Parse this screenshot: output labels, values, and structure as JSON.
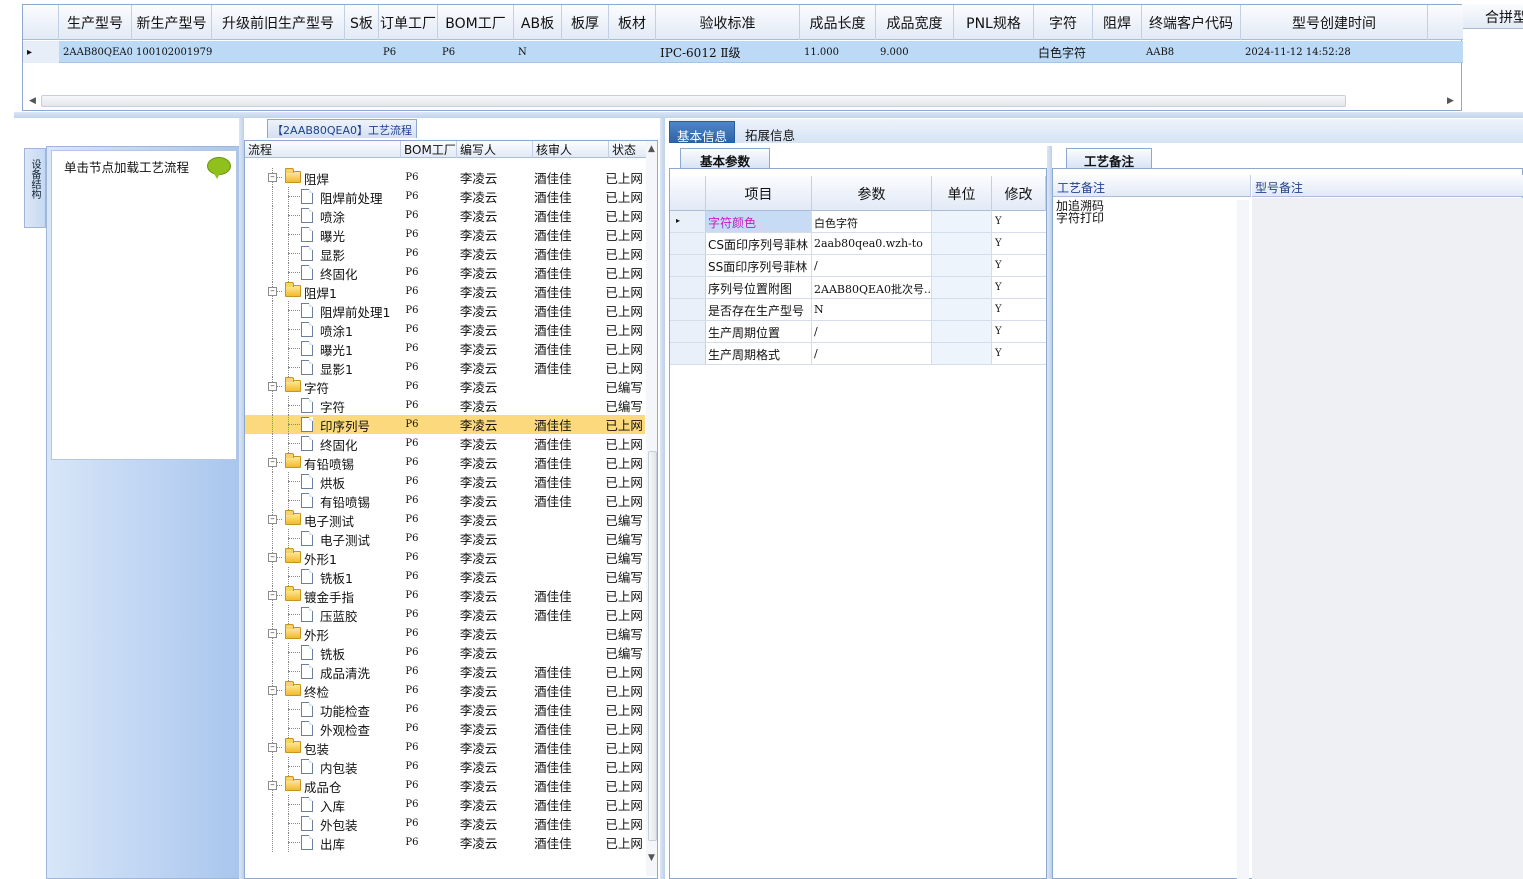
{
  "top_grid": {
    "headers": [
      "生产型号",
      "新生产型号",
      "升级前旧生产型号",
      "S板",
      "订单工厂",
      "BOM工厂",
      "AB板",
      "板厚",
      "板材",
      "验收标准",
      "成品长度",
      "成品宽度",
      "PNL规格",
      "字符",
      "阻焊",
      "终端客户代码",
      "型号创建时间"
    ],
    "row": [
      "2AAB80QEA0",
      "10010200197916",
      "",
      "",
      "P6",
      "P6",
      "N",
      "",
      "",
      "IPC-6012 Ⅱ级",
      "11.000",
      "9.000",
      "",
      "白色字符",
      "",
      "AAB8",
      "2024-11-12 14:52:28"
    ]
  },
  "merge_label": "合拼型",
  "left_panel": {
    "vertical_tab": "设备结构",
    "hint": "单击节点加载工艺流程"
  },
  "process": {
    "title": "【2AAB80QEA0】工艺流程",
    "headers": [
      "流程",
      "BOM工厂",
      "编写人",
      "核审人",
      "状态"
    ],
    "rows": [
      {
        "level": 1,
        "type": "folder",
        "name": "阻焊",
        "bom": "P6",
        "writer": "李凌云",
        "reviewer": "酒佳佳",
        "status": "已上网"
      },
      {
        "level": 2,
        "type": "doc",
        "name": "阻焊前处理",
        "bom": "P6",
        "writer": "李凌云",
        "reviewer": "酒佳佳",
        "status": "已上网"
      },
      {
        "level": 2,
        "type": "doc",
        "name": "喷涂",
        "bom": "P6",
        "writer": "李凌云",
        "reviewer": "酒佳佳",
        "status": "已上网"
      },
      {
        "level": 2,
        "type": "doc",
        "name": "曝光",
        "bom": "P6",
        "writer": "李凌云",
        "reviewer": "酒佳佳",
        "status": "已上网"
      },
      {
        "level": 2,
        "type": "doc",
        "name": "显影",
        "bom": "P6",
        "writer": "李凌云",
        "reviewer": "酒佳佳",
        "status": "已上网"
      },
      {
        "level": 2,
        "type": "doc",
        "name": "终固化",
        "bom": "P6",
        "writer": "李凌云",
        "reviewer": "酒佳佳",
        "status": "已上网"
      },
      {
        "level": 1,
        "type": "folder",
        "name": "阻焊1",
        "bom": "P6",
        "writer": "李凌云",
        "reviewer": "酒佳佳",
        "status": "已上网"
      },
      {
        "level": 2,
        "type": "doc",
        "name": "阻焊前处理1",
        "bom": "P6",
        "writer": "李凌云",
        "reviewer": "酒佳佳",
        "status": "已上网"
      },
      {
        "level": 2,
        "type": "doc",
        "name": "喷涂1",
        "bom": "P6",
        "writer": "李凌云",
        "reviewer": "酒佳佳",
        "status": "已上网"
      },
      {
        "level": 2,
        "type": "doc",
        "name": "曝光1",
        "bom": "P6",
        "writer": "李凌云",
        "reviewer": "酒佳佳",
        "status": "已上网"
      },
      {
        "level": 2,
        "type": "doc",
        "name": "显影1",
        "bom": "P6",
        "writer": "李凌云",
        "reviewer": "酒佳佳",
        "status": "已上网"
      },
      {
        "level": 1,
        "type": "folder",
        "name": "字符",
        "bom": "P6",
        "writer": "李凌云",
        "reviewer": "",
        "status": "已编写"
      },
      {
        "level": 2,
        "type": "doc",
        "name": "字符",
        "bom": "P6",
        "writer": "李凌云",
        "reviewer": "",
        "status": "已编写"
      },
      {
        "level": 2,
        "type": "doc",
        "name": "印序列号",
        "bom": "P6",
        "writer": "李凌云",
        "reviewer": "酒佳佳",
        "status": "已上网",
        "selected": true
      },
      {
        "level": 2,
        "type": "doc",
        "name": "终固化",
        "bom": "P6",
        "writer": "李凌云",
        "reviewer": "酒佳佳",
        "status": "已上网"
      },
      {
        "level": 1,
        "type": "folder",
        "name": "有铅喷锡",
        "bom": "P6",
        "writer": "李凌云",
        "reviewer": "酒佳佳",
        "status": "已上网"
      },
      {
        "level": 2,
        "type": "doc",
        "name": "烘板",
        "bom": "P6",
        "writer": "李凌云",
        "reviewer": "酒佳佳",
        "status": "已上网"
      },
      {
        "level": 2,
        "type": "doc",
        "name": "有铅喷锡",
        "bom": "P6",
        "writer": "李凌云",
        "reviewer": "酒佳佳",
        "status": "已上网"
      },
      {
        "level": 1,
        "type": "folder",
        "name": "电子测试",
        "bom": "P6",
        "writer": "李凌云",
        "reviewer": "",
        "status": "已编写"
      },
      {
        "level": 2,
        "type": "doc",
        "name": "电子测试",
        "bom": "P6",
        "writer": "李凌云",
        "reviewer": "",
        "status": "已编写"
      },
      {
        "level": 1,
        "type": "folder",
        "name": "外形1",
        "bom": "P6",
        "writer": "李凌云",
        "reviewer": "",
        "status": "已编写"
      },
      {
        "level": 2,
        "type": "doc",
        "name": "铣板1",
        "bom": "P6",
        "writer": "李凌云",
        "reviewer": "",
        "status": "已编写"
      },
      {
        "level": 1,
        "type": "folder",
        "name": "镀金手指",
        "bom": "P6",
        "writer": "李凌云",
        "reviewer": "酒佳佳",
        "status": "已上网"
      },
      {
        "level": 2,
        "type": "doc",
        "name": "压蓝胶",
        "bom": "P6",
        "writer": "李凌云",
        "reviewer": "酒佳佳",
        "status": "已上网"
      },
      {
        "level": 1,
        "type": "folder",
        "name": "外形",
        "bom": "P6",
        "writer": "李凌云",
        "reviewer": "",
        "status": "已编写"
      },
      {
        "level": 2,
        "type": "doc",
        "name": "铣板",
        "bom": "P6",
        "writer": "李凌云",
        "reviewer": "",
        "status": "已编写"
      },
      {
        "level": 2,
        "type": "doc",
        "name": "成品清洗",
        "bom": "P6",
        "writer": "李凌云",
        "reviewer": "酒佳佳",
        "status": "已上网"
      },
      {
        "level": 1,
        "type": "folder",
        "name": "终检",
        "bom": "P6",
        "writer": "李凌云",
        "reviewer": "酒佳佳",
        "status": "已上网"
      },
      {
        "level": 2,
        "type": "doc",
        "name": "功能检查",
        "bom": "P6",
        "writer": "李凌云",
        "reviewer": "酒佳佳",
        "status": "已上网"
      },
      {
        "level": 2,
        "type": "doc",
        "name": "外观检查",
        "bom": "P6",
        "writer": "李凌云",
        "reviewer": "酒佳佳",
        "status": "已上网"
      },
      {
        "level": 1,
        "type": "folder",
        "name": "包装",
        "bom": "P6",
        "writer": "李凌云",
        "reviewer": "酒佳佳",
        "status": "已上网"
      },
      {
        "level": 2,
        "type": "doc",
        "name": "内包装",
        "bom": "P6",
        "writer": "李凌云",
        "reviewer": "酒佳佳",
        "status": "已上网"
      },
      {
        "level": 1,
        "type": "folder",
        "name": "成品仓",
        "bom": "P6",
        "writer": "李凌云",
        "reviewer": "酒佳佳",
        "status": "已上网"
      },
      {
        "level": 2,
        "type": "doc",
        "name": "入库",
        "bom": "P6",
        "writer": "李凌云",
        "reviewer": "酒佳佳",
        "status": "已上网"
      },
      {
        "level": 2,
        "type": "doc",
        "name": "外包装",
        "bom": "P6",
        "writer": "李凌云",
        "reviewer": "酒佳佳",
        "status": "已上网"
      },
      {
        "level": 2,
        "type": "doc",
        "name": "出库",
        "bom": "P6",
        "writer": "李凌云",
        "reviewer": "酒佳佳",
        "status": "已上网"
      }
    ]
  },
  "right_tabs": [
    "基本信息",
    "拓展信息"
  ],
  "basic_params": {
    "tab": "基本参数",
    "headers": [
      "项目",
      "参数",
      "单位",
      "修改"
    ],
    "rows": [
      {
        "item": "字符颜色",
        "value": "白色字符",
        "unit": "",
        "modify": "Y",
        "highlight": true
      },
      {
        "item": "CS面印序列号菲林",
        "value": "2aab80qea0.wzh-to",
        "unit": "",
        "modify": "Y"
      },
      {
        "item": "SS面印序列号菲林",
        "value": "/",
        "unit": "",
        "modify": "Y"
      },
      {
        "item": "序列号位置附图",
        "value": "2AAB80QEA0批次号...",
        "unit": "",
        "modify": "Y"
      },
      {
        "item": "是否存在生产型号",
        "value": "N",
        "unit": "",
        "modify": "Y"
      },
      {
        "item": "生产周期位置",
        "value": "/",
        "unit": "",
        "modify": "Y"
      },
      {
        "item": "生产周期格式",
        "value": "/",
        "unit": "",
        "modify": "Y"
      }
    ]
  },
  "process_notes": {
    "tab": "工艺备注",
    "col1": "工艺备注",
    "col2": "型号备注",
    "lines": [
      "加追溯码",
      "字符打印"
    ]
  },
  "colors": {
    "accent": "#2d64a8",
    "selected_row": "#fcd97c",
    "grid_select": "#bcd9f5",
    "highlight_text": "#c020c0"
  }
}
